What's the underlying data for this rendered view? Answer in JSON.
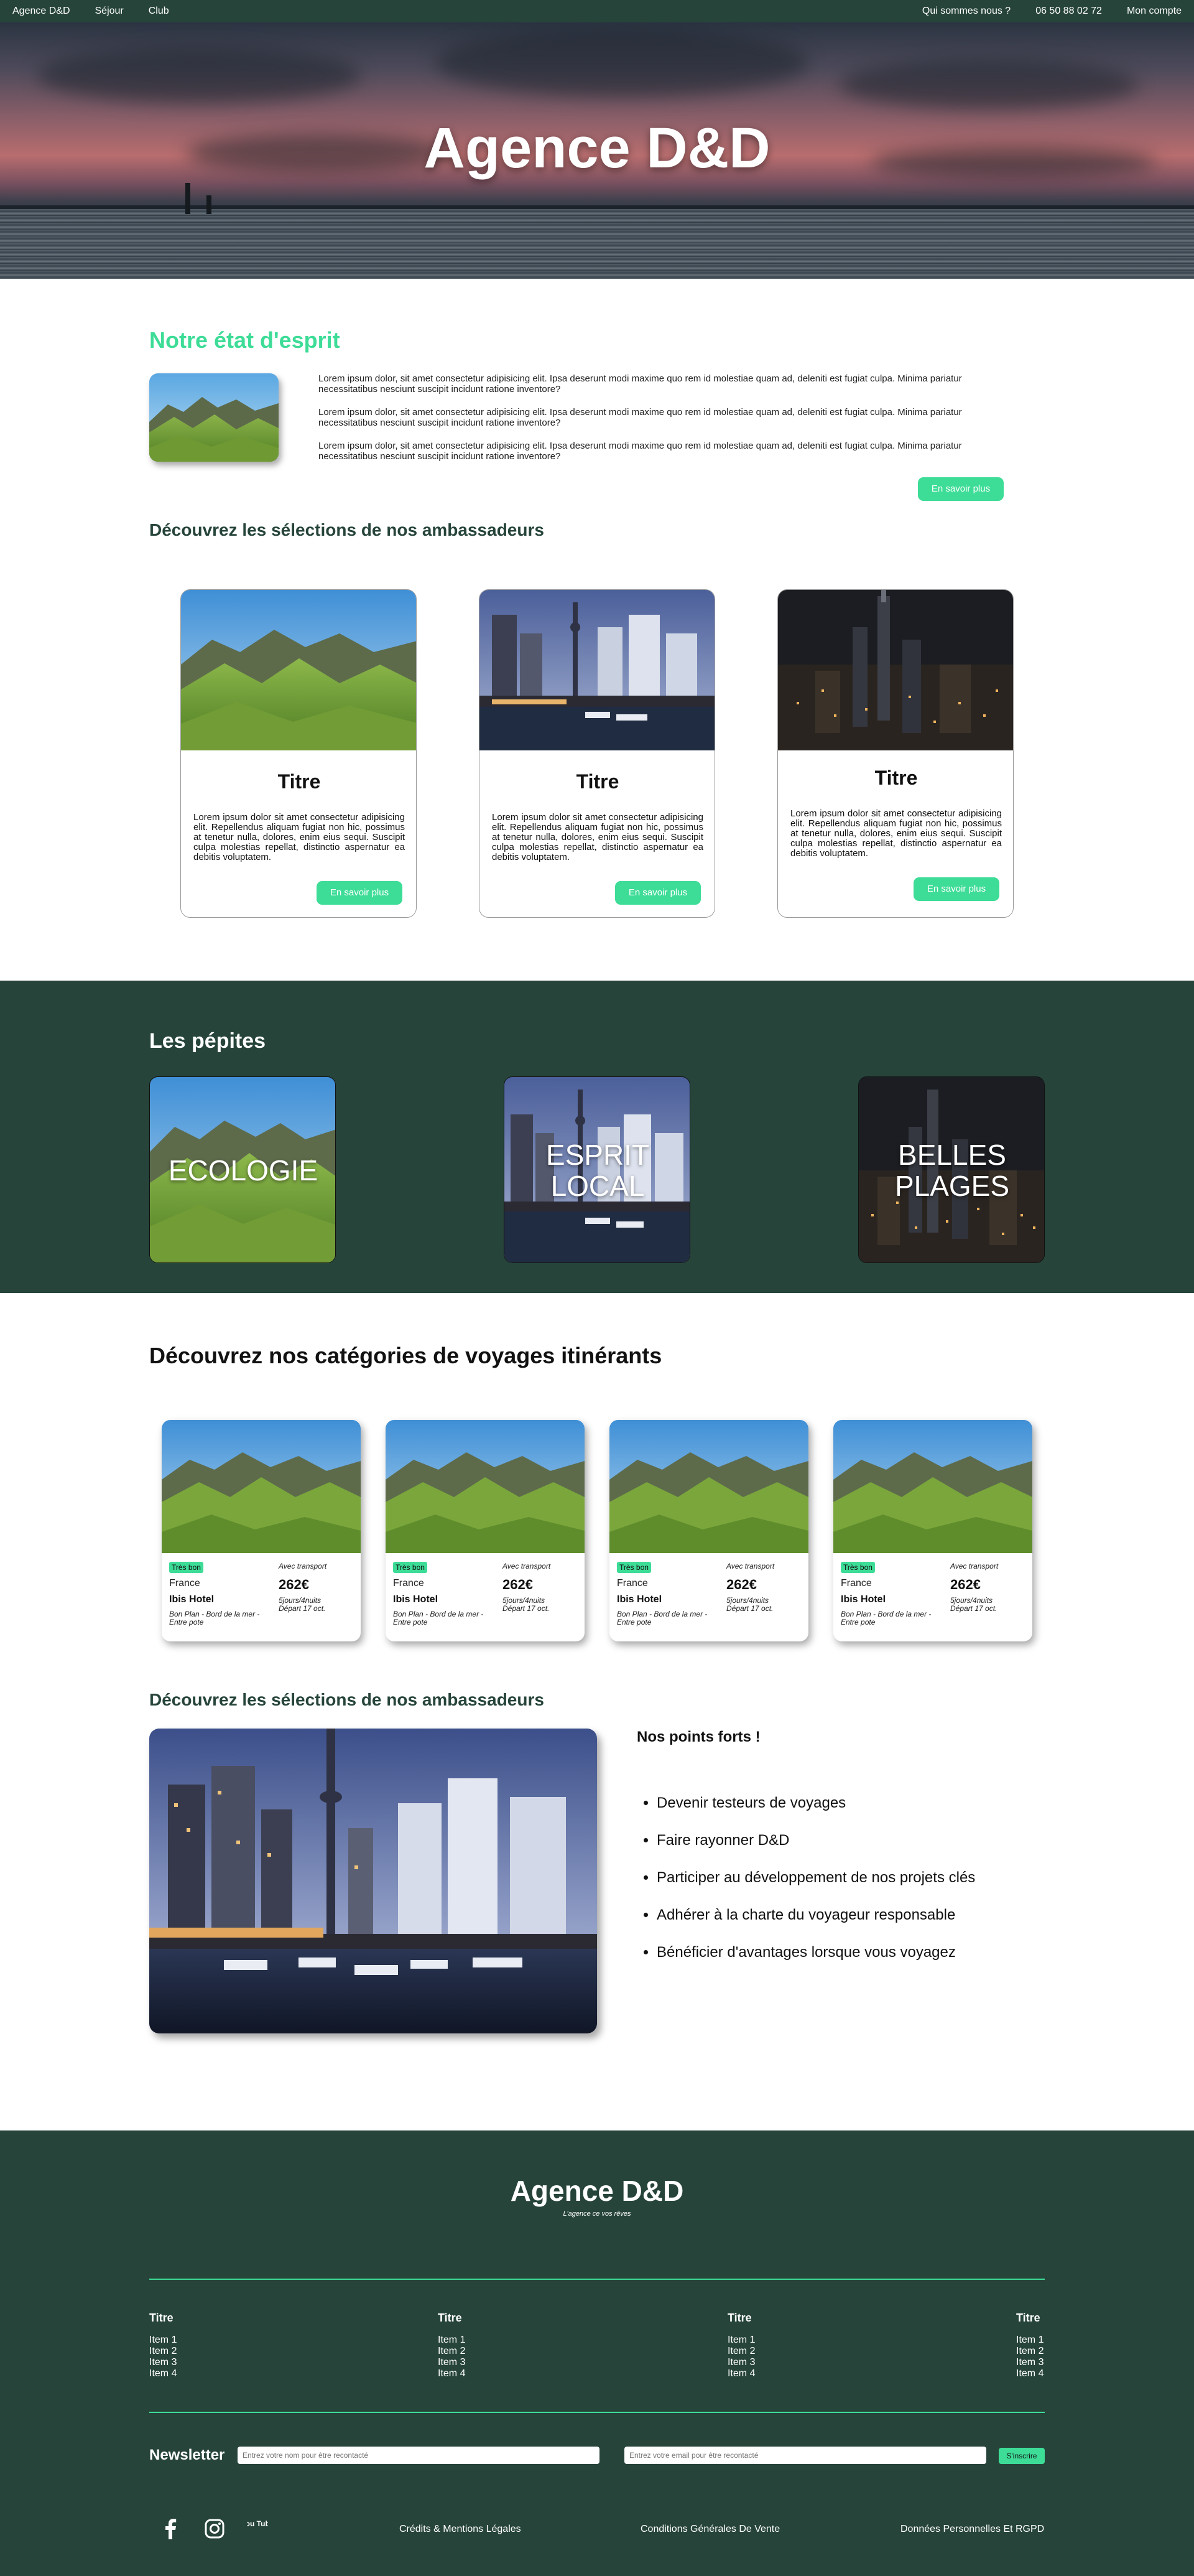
{
  "nav": {
    "left": [
      "Agence D&D",
      "Séjour",
      "Club"
    ],
    "right": [
      "Qui sommes nous ?",
      "06 50 88 02 72",
      "Mon compte"
    ]
  },
  "hero": {
    "title": "Agence D&D"
  },
  "esprit": {
    "title": "Notre état d'esprit",
    "paragraphs": [
      "Lorem ipsum dolor, sit amet consectetur adipisicing elit. Ipsa deserunt modi maxime quo rem id molestiae quam ad, deleniti est fugiat culpa. Minima pariatur necessitatibus nesciunt suscipit incidunt ratione inventore?",
      "Lorem ipsum dolor, sit amet consectetur adipisicing elit. Ipsa deserunt modi maxime quo rem id molestiae quam ad, deleniti est fugiat culpa. Minima pariatur necessitatibus nesciunt suscipit incidunt ratione inventore?",
      "Lorem ipsum dolor, sit amet consectetur adipisicing elit. Ipsa deserunt modi maxime quo rem id molestiae quam ad, deleniti est fugiat culpa. Minima pariatur necessitatibus nesciunt suscipit incidunt ratione inventore?"
    ],
    "button": "En savoir plus"
  },
  "ambassadors": {
    "title": "Découvrez les sélections de nos ambassadeurs",
    "cards": [
      {
        "title": "Titre",
        "text": "Lorem ipsum dolor sit amet consectetur adipisicing elit. Repellendus aliquam fugiat non hic, possimus at tenetur nulla, dolores, enim eius sequi. Suscipit culpa molestias repellat, distinctio aspernatur ea debitis voluptatem.",
        "button": "En savoir plus"
      },
      {
        "title": "Titre",
        "text": "Lorem ipsum dolor sit amet consectetur adipisicing elit. Repellendus aliquam fugiat non hic, possimus at tenetur nulla, dolores, enim eius sequi. Suscipit culpa molestias repellat, distinctio aspernatur ea debitis voluptatem.",
        "button": "En savoir plus"
      },
      {
        "title": "Titre",
        "text": "Lorem ipsum dolor sit amet consectetur adipisicing elit. Repellendus aliquam fugiat non hic, possimus at tenetur nulla, dolores, enim eius sequi. Suscipit culpa molestias repellat, distinctio aspernatur ea debitis voluptatem.",
        "button": "En savoir plus"
      }
    ]
  },
  "pepites": {
    "title": "Les pépites",
    "tiles": [
      "ECOLOGIE",
      "ESPRIT LOCAL",
      "BELLES PLAGES"
    ]
  },
  "categories": {
    "title": "Découvrez nos catégories de voyages itinérants",
    "cards": [
      {
        "badge": "Très bon",
        "transport": "Avec transport",
        "country": "France",
        "price": "262€",
        "hotel": "Ibis Hotel",
        "plan": "Bon Plan - Bord de la mer - Entre pote",
        "nights": "5jours/4nuits",
        "depart": "Départ 17 oct."
      },
      {
        "badge": "Très bon",
        "transport": "Avec transport",
        "country": "France",
        "price": "262€",
        "hotel": "Ibis Hotel",
        "plan": "Bon Plan - Bord de la mer - Entre pote",
        "nights": "5jours/4nuits",
        "depart": "Départ 17 oct."
      },
      {
        "badge": "Très bon",
        "transport": "Avec transport",
        "country": "France",
        "price": "262€",
        "hotel": "Ibis Hotel",
        "plan": "Bon Plan - Bord de la mer - Entre pote",
        "nights": "5jours/4nuits",
        "depart": "Départ 17 oct."
      },
      {
        "badge": "Très bon",
        "transport": "Avec transport",
        "country": "France",
        "price": "262€",
        "hotel": "Ibis Hotel",
        "plan": "Bon Plan - Bord de la mer - Entre pote",
        "nights": "5jours/4nuits",
        "depart": "Départ 17 oct."
      }
    ]
  },
  "points": {
    "title": "Découvrez les sélections de nos ambassadeurs",
    "heading": "Nos points forts !",
    "items": [
      "Devenir testeurs de voyages",
      "Faire rayonner D&D",
      "Participer au développement de nos projets clés",
      "Adhérer à la charte du voyageur responsable",
      "Bénéficier d'avantages lorsque vous voyagez"
    ]
  },
  "footer": {
    "brand": "Agence D&D",
    "tagline": "L'agence ce vos rêves",
    "columns": [
      {
        "title": "Titre",
        "items": [
          "Item 1",
          "Item 2",
          "Item 3",
          "Item 4"
        ]
      },
      {
        "title": "Titre",
        "items": [
          "Item 1",
          "Item 2",
          "Item 3",
          "Item 4"
        ]
      },
      {
        "title": "Titre",
        "items": [
          "Item 1",
          "Item 2",
          "Item 3",
          "Item 4"
        ]
      },
      {
        "title": "Titre",
        "items": [
          "Item 1",
          "Item 2",
          "Item 3",
          "Item 4"
        ]
      }
    ],
    "newsletter": {
      "label": "Newsletter",
      "name_placeholder": "Entrez votre nom pour être recontacté",
      "email_placeholder": "Entrez votre email pour être recontacté",
      "button": "S'inscrire"
    },
    "social_icons": [
      "facebook-icon",
      "instagram-icon",
      "youtube-icon"
    ],
    "youtube_text": "You Tube",
    "links": [
      "Crédits & Mentions Légales",
      "Conditions Générales De Vente",
      "Données Personnelles Et RGPD"
    ]
  },
  "colors": {
    "dark_green": "#26443a",
    "accent_green": "#3ddc97",
    "white": "#ffffff"
  }
}
